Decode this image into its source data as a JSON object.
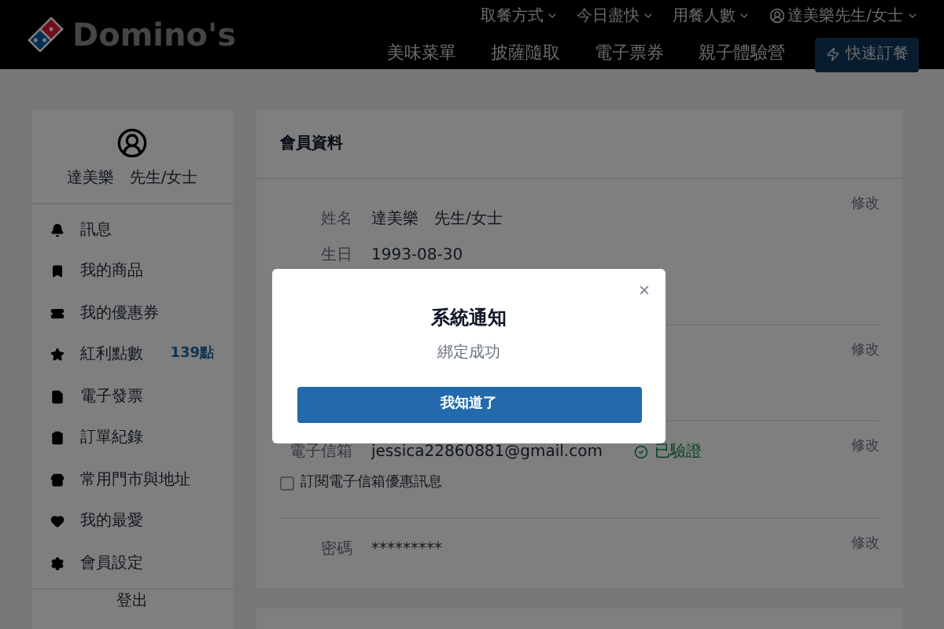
{
  "header": {
    "logo_text": "Domino's",
    "utility_links": [
      {
        "label": "取餐方式"
      },
      {
        "label": "今日盡快"
      },
      {
        "label": "用餐人數"
      }
    ],
    "account": {
      "label": "達美樂先生/女士"
    },
    "nav": [
      {
        "label": "美味菜單"
      },
      {
        "label": "披薩隨取"
      },
      {
        "label": "電子票券"
      },
      {
        "label": "親子體驗營"
      }
    ],
    "quick_order": {
      "label": "快速訂餐"
    }
  },
  "sidebar": {
    "user_name": "達美樂　先生/女士",
    "items": [
      {
        "label": "訊息"
      },
      {
        "label": "我的商品"
      },
      {
        "label": "我的優惠券"
      },
      {
        "label": "紅利點數",
        "badge": "139點"
      },
      {
        "label": "電子發票"
      },
      {
        "label": "訂單紀錄"
      },
      {
        "label": "常用門市與地址"
      },
      {
        "label": "我的最愛"
      },
      {
        "label": "會員設定"
      }
    ],
    "logout": "登出"
  },
  "profile": {
    "title": "會員資料",
    "sections": [
      {
        "rows": [
          {
            "label": "姓名",
            "value": "達美樂　先生/女士"
          },
          {
            "label": "生日",
            "value": "1993-08-30"
          }
        ],
        "edit": "修改"
      },
      {
        "edit": "修改"
      },
      {
        "rows": [
          {
            "label": "電子信箱",
            "value": "jessica22860881@gmail.com",
            "verified": "已驗證"
          }
        ],
        "subscribe": {
          "label": "訂閱電子信箱優惠訊息",
          "checked": false
        },
        "edit": "修改"
      },
      {
        "rows": [
          {
            "label": "密碼",
            "value": "*********"
          }
        ],
        "edit": "修改"
      }
    ]
  },
  "dialog": {
    "title": "系統通知",
    "message": "綁定成功",
    "button": "我知道了"
  }
}
